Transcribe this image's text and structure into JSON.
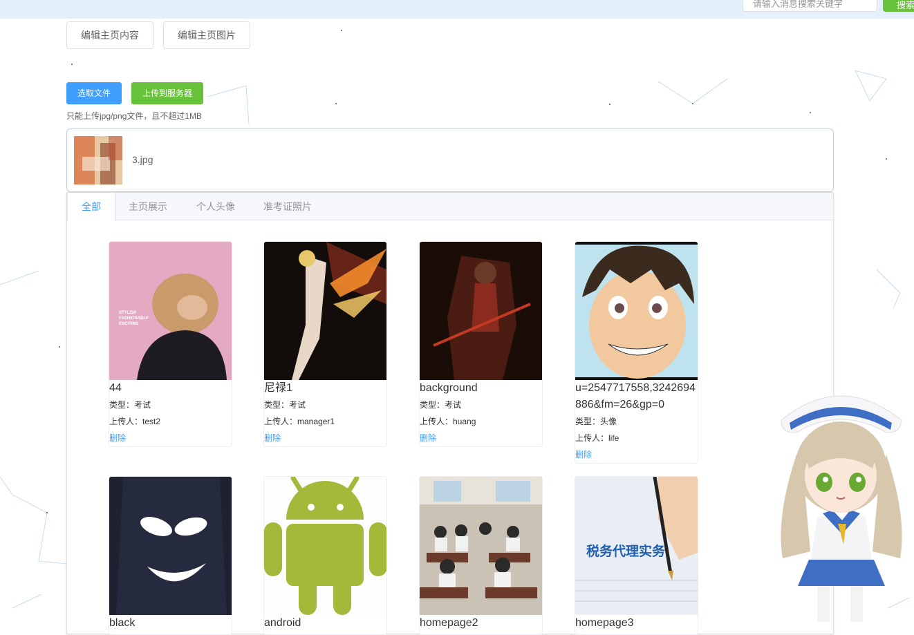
{
  "header": {
    "search_placeholder": "请输入消息搜索关键字",
    "search_button": "搜索"
  },
  "actions": {
    "edit_content": "编辑主页内容",
    "edit_images": "编辑主页图片",
    "select_file": "选取文件",
    "upload_server": "上传到服务器",
    "tip": "只能上传jpg/png文件，且不超过1MB"
  },
  "upload": {
    "file_name": "3.jpg"
  },
  "tabs": [
    {
      "label": "全部",
      "active": true
    },
    {
      "label": "主页展示",
      "active": false
    },
    {
      "label": "个人头像",
      "active": false
    },
    {
      "label": "准考证照片",
      "active": false
    }
  ],
  "images": [
    {
      "name": "44",
      "type": "类型：考试",
      "uploader": "上传人：test2",
      "delete": "删除",
      "art_text": [
        "STYLISH",
        "FASHIONABLE",
        "EXCITING"
      ]
    },
    {
      "name": "尼禄1",
      "type": "类型：考试",
      "uploader": "上传人：manager1",
      "delete": "删除"
    },
    {
      "name": "background",
      "type": "类型：考试",
      "uploader": "上传人：huang",
      "delete": "删除"
    },
    {
      "name": "u=2547717558,3242694886&fm=26&gp=0",
      "type": "类型：头像",
      "uploader": "上传人：life",
      "delete": "删除"
    },
    {
      "name": "black",
      "type": "",
      "uploader": "",
      "delete": ""
    },
    {
      "name": "android",
      "type": "",
      "uploader": "",
      "delete": ""
    },
    {
      "name": "homepage2",
      "type": "",
      "uploader": "",
      "delete": ""
    },
    {
      "name": "homepage3",
      "type": "",
      "uploader": "",
      "delete": "",
      "art_text": "税务代理实务"
    }
  ],
  "colors": {
    "primary": "#409eff",
    "success": "#67c23a",
    "topbar": "#e4f0fb"
  }
}
